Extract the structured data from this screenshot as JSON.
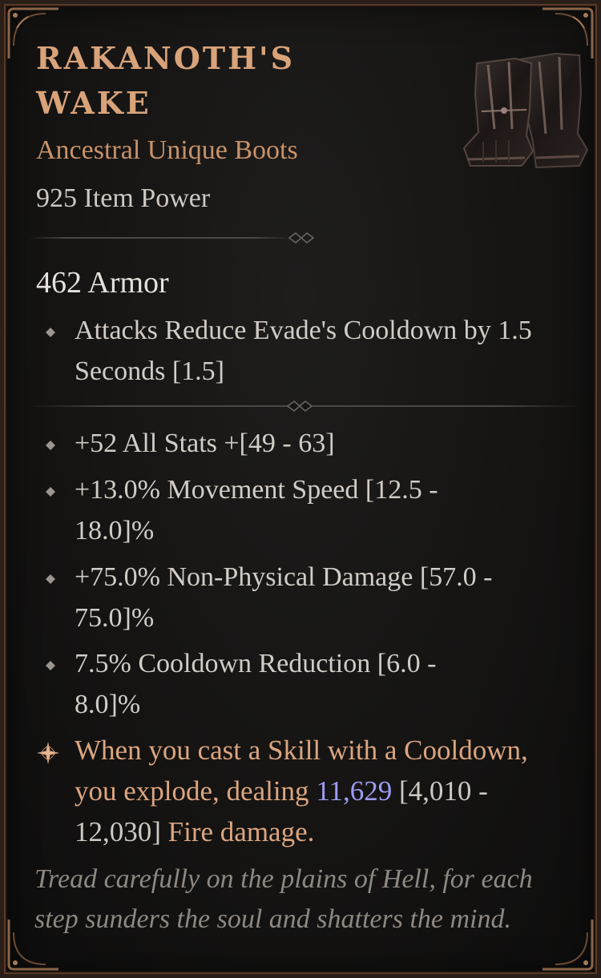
{
  "item": {
    "name": "RAKANOTH'S WAKE",
    "type_line": "Ancestral Unique Boots",
    "item_power": "925 Item Power",
    "icon": "boots-icon"
  },
  "armor": "462 Armor",
  "implicit": {
    "text": "Attacks Reduce Evade's Cooldown by 1.5 Seconds [1.5]"
  },
  "affixes": [
    {
      "text": "+52 All Stats +[49 - 63]"
    },
    {
      "text": "+13.0% Movement Speed [12.5 - 18.0]%"
    },
    {
      "text": "+75.0% Non-Physical Damage [57.0 - 75.0]%"
    },
    {
      "text": "7.5% Cooldown Reduction [6.0 - 8.0]%"
    }
  ],
  "unique_power": {
    "lead": "When you cast a Skill with a Cooldown, you explode, dealing",
    "value": "11,629",
    "range": "[4,010 - 12,030]",
    "tail": "Fire damage."
  },
  "flavor": "Tread carefully on the plains of Hell, for each step sunders the soul and shatters the mind.",
  "colors": {
    "title": "#d9a37a",
    "unique_text": "#dca57f",
    "rolled_value": "#9d9cf2",
    "affix_text": "#d2ccc6",
    "flavor": "#8e8881"
  }
}
